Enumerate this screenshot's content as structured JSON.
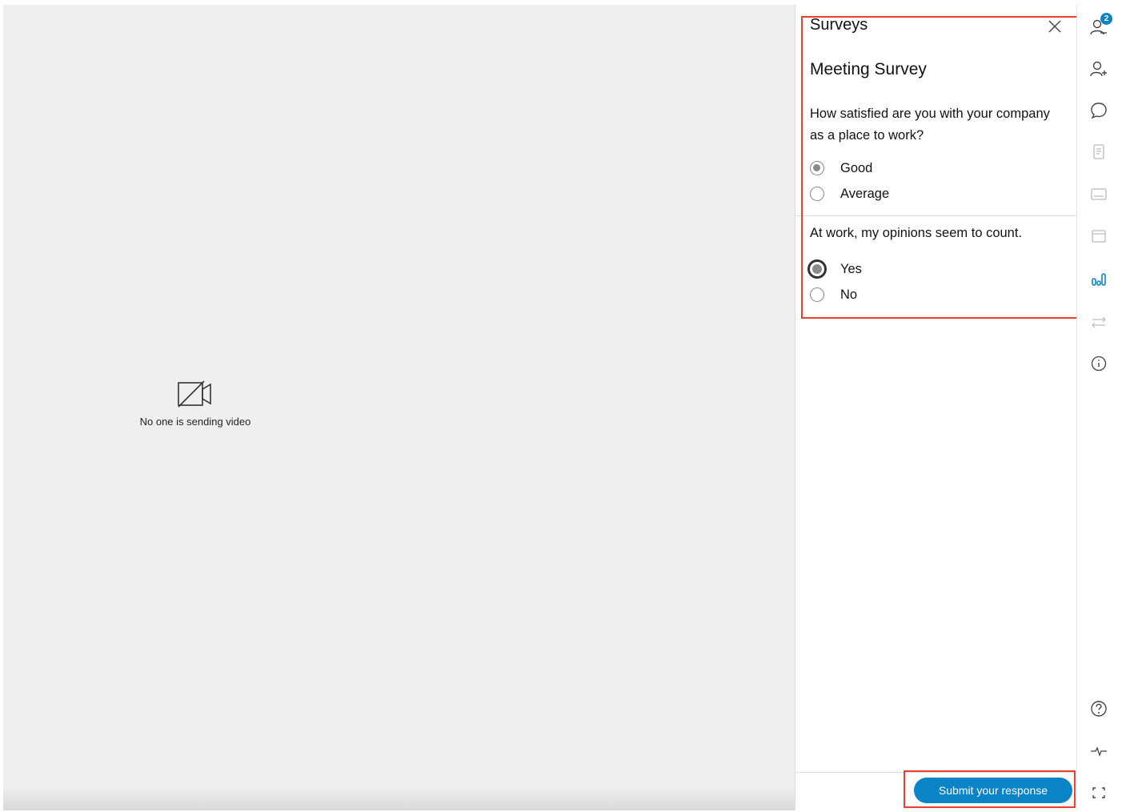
{
  "video": {
    "empty_message": "No one is sending video"
  },
  "panel": {
    "title": "Surveys",
    "survey_title": "Meeting Survey",
    "questions": [
      {
        "text": "How satisfied are you with your company as a place to work?",
        "options": [
          {
            "label": "Good",
            "checked": true
          },
          {
            "label": "Average",
            "checked": false
          }
        ]
      },
      {
        "text": "At work, my opinions seem to count.",
        "options": [
          {
            "label": "Yes",
            "checked": true
          },
          {
            "label": "No",
            "checked": false
          }
        ]
      }
    ],
    "submit_label": "Submit your response"
  },
  "rail": {
    "participants_badge": "2",
    "icons": [
      "participants-icon",
      "add-participant-icon",
      "chat-icon",
      "notes-icon",
      "captions-icon",
      "calendar-icon",
      "polling-icon",
      "transfer-icon",
      "info-icon",
      "help-icon",
      "health-icon",
      "fullscreen-icon"
    ]
  },
  "colors": {
    "accent": "#0a84c6",
    "highlight": "#e8412e",
    "video_bg": "#efefef"
  }
}
